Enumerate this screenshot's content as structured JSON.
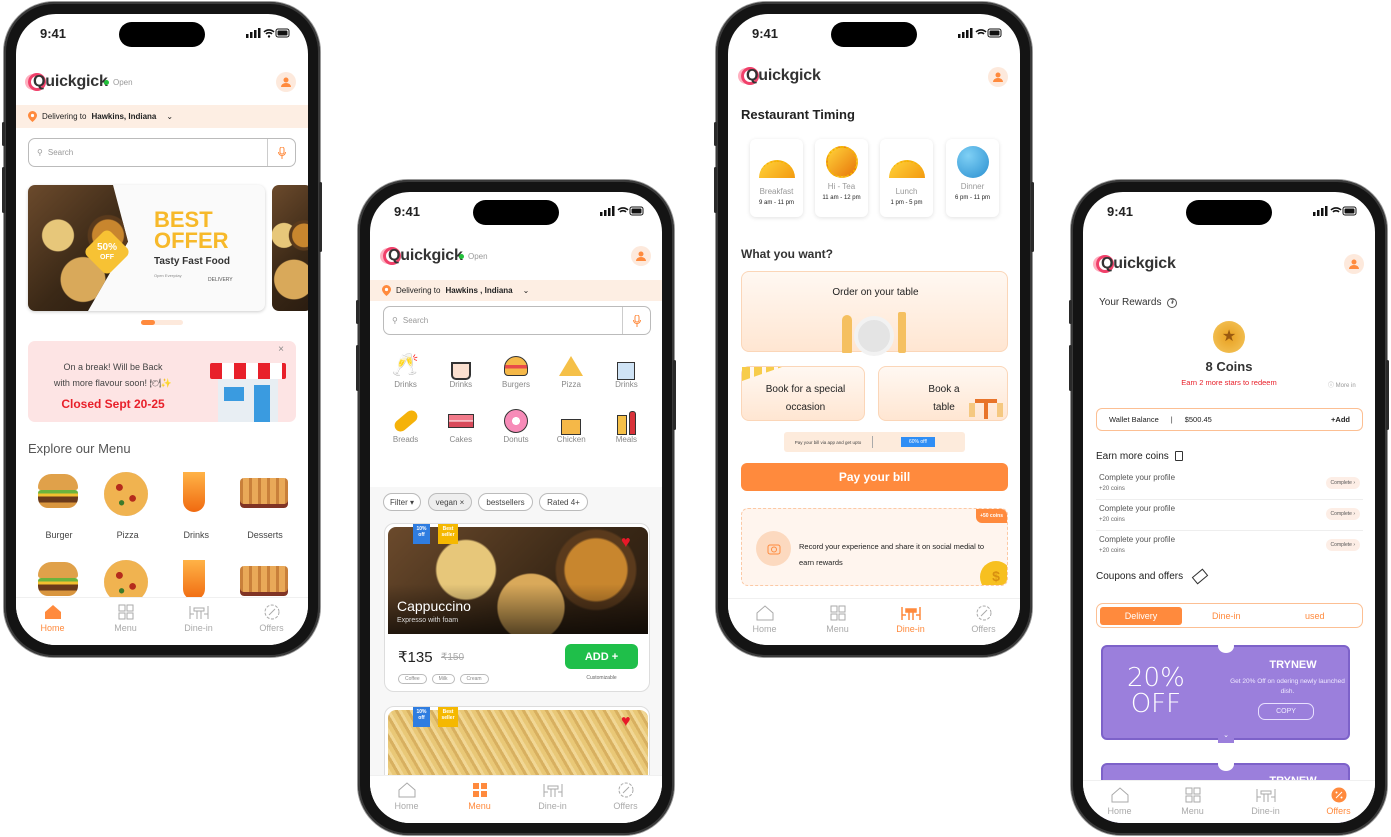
{
  "status_time": "9:41",
  "brand": "Quickgick",
  "colors": {
    "accent": "#ff8a3d",
    "open": "#22c03a",
    "closed": "#e8202a",
    "add": "#1fbf4a",
    "coupon": "#9b7fdc"
  },
  "nav": [
    {
      "label": "Home",
      "icon": "home-icon"
    },
    {
      "label": "Menu",
      "icon": "grid-icon"
    },
    {
      "label": "Dine-in",
      "icon": "table-icon"
    },
    {
      "label": "Offers",
      "icon": "discount-icon"
    }
  ],
  "home": {
    "open": "Open",
    "deliver_prefix": "Delivering to",
    "location": "Hawkins, Indiana",
    "search_placeholder": "Search",
    "banner": {
      "line1": "BEST",
      "line2": "OFFER",
      "sub": "Tasty Fast Food",
      "badge_pct": "50%",
      "badge_off": "OFF",
      "open_hours": "Open Everyday",
      "delivery": "DELIVERY"
    },
    "closed": {
      "line1": "On a break! Will be Back",
      "line2": "with more flavour soon! 🍽✨",
      "date": "Closed Sept 20-25"
    },
    "explore_title": "Explore our Menu",
    "menu": [
      "Burger",
      "Pizza",
      "Drinks",
      "Desserts"
    ],
    "active_nav": "Home"
  },
  "menu": {
    "open": "Open",
    "deliver_prefix": "Delivering to",
    "location": "Hawkins , Indiana",
    "search_placeholder": "Search",
    "categories": [
      "Drinks",
      "Drinks",
      "Burgers",
      "Pizza",
      "Drinks",
      "Breads",
      "Cakes",
      "Donuts",
      "Chicken",
      "Meals"
    ],
    "filters": [
      "Filter ▾",
      "vegan ×",
      "bestsellers",
      "Rated 4+"
    ],
    "item": {
      "name": "Cappuccino",
      "desc": "Expresso with foam",
      "price": "₹135",
      "old_price": "₹150",
      "add": "ADD +",
      "customizable": "Customizable",
      "tags": [
        "Coffee",
        "Milk",
        "Cream"
      ],
      "badge1": "10% off",
      "badge2": "Best seller"
    },
    "item2": {
      "badge1": "10% off",
      "badge2": "Best seller"
    },
    "active_nav": "Menu"
  },
  "dinein": {
    "timing_title": "Restaurant Timing",
    "timings": [
      {
        "name": "Breakfast",
        "time": "9 am - 11 pm"
      },
      {
        "name": "Hi - Tea",
        "time": "11 am - 12 pm"
      },
      {
        "name": "Lunch",
        "time": "1 pm - 5 pm"
      },
      {
        "name": "Dinner",
        "time": "6 pm - 11 pm"
      }
    ],
    "want_title": "What you want?",
    "order_table": "Order on your table",
    "book_occasion": "Book for a special occasion",
    "book_table": "Book a table",
    "pay_banner": "Pay your bill via app and get upto",
    "pay_offer": "60% off!",
    "pay_button": "Pay your bill",
    "record": "Record your experience and share it on social medial to earn rewards",
    "record_badge": "+50 coins",
    "active_nav": "Dine-in"
  },
  "offers": {
    "rewards_title": "Your Rewards",
    "coins": "8 Coins",
    "earn_hint": "Earn 2 more stars to redeem",
    "more_info": "More in",
    "wallet_label": "Wallet Balance",
    "wallet_value": "$500.45",
    "wallet_add": "+Add",
    "earn_title": "Earn more coins",
    "tasks": [
      {
        "title": "Complete your profile",
        "reward": "+20 coins",
        "button": "Complete ›"
      },
      {
        "title": "Complete your profile",
        "reward": "+20 coins",
        "button": "Complete ›"
      },
      {
        "title": "Complete your profile",
        "reward": "+20 coins",
        "button": "Complete ›"
      }
    ],
    "coupons_title": "Coupons and offers",
    "tabs": [
      "Delivery",
      "Dine-in",
      "used"
    ],
    "active_tab": "Delivery",
    "coupon": {
      "pct": "20%",
      "off": "OFF",
      "code": "TRYNEW",
      "desc": "Get 20% Off on odering newly launched dish.",
      "copy": "COPY"
    },
    "coupon2_code": "TRYNEW",
    "active_nav": "Offers"
  }
}
